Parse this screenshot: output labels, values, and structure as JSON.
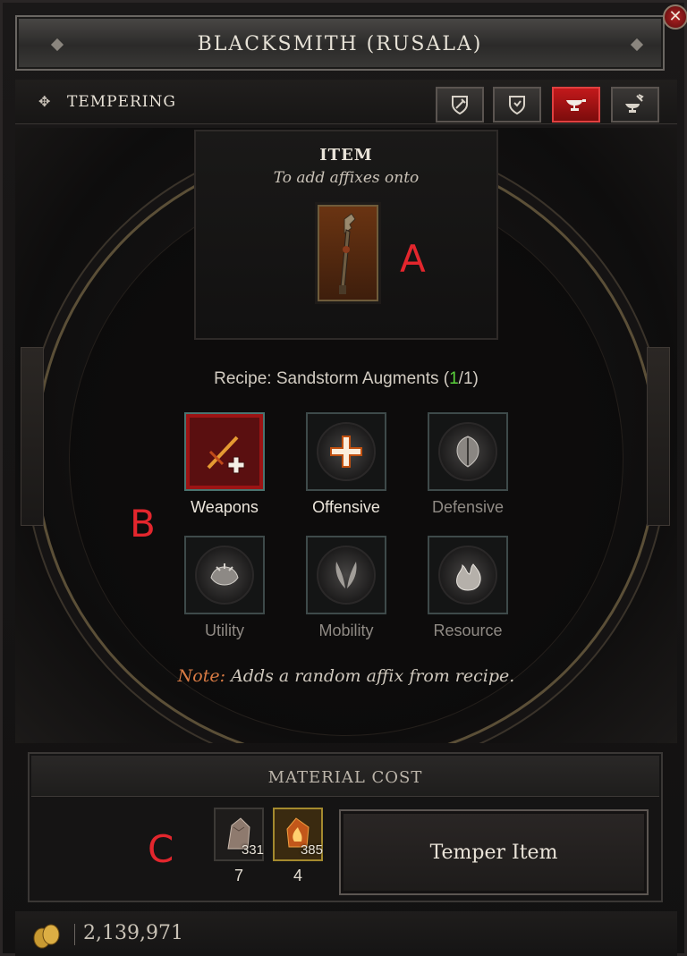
{
  "header": {
    "title": "BLACKSMITH (RUSALA)",
    "close_icon": "close-icon"
  },
  "subbar": {
    "tab_label": "TEMPERING",
    "tab_icon": "diamond-cross-icon",
    "modes": [
      {
        "name": "salvage-mode",
        "icon": "hammer-shield-icon",
        "active": false
      },
      {
        "name": "repair-mode",
        "icon": "shield-icon",
        "active": false
      },
      {
        "name": "temper-mode",
        "icon": "anvil-icon",
        "active": true
      },
      {
        "name": "masterwork-mode",
        "icon": "anvil-hammer-icon",
        "active": false
      }
    ],
    "active_color": "#c2191b"
  },
  "item": {
    "title": "ITEM",
    "subtitle": "To add affixes onto",
    "icon": "polearm-icon"
  },
  "annotations": {
    "a": "A",
    "b": "B",
    "c": "C"
  },
  "recipe": {
    "prefix": "Recipe: Sandstorm Augments (",
    "count": "1",
    "suffix": "/1)"
  },
  "affixes": [
    {
      "label": "Weapons",
      "icon": "weapons-icon",
      "selected": true,
      "enabled": true
    },
    {
      "label": "Offensive",
      "icon": "offensive-cross-icon",
      "selected": false,
      "enabled": true
    },
    {
      "label": "Defensive",
      "icon": "defensive-shield-icon",
      "selected": false,
      "enabled": false
    },
    {
      "label": "Utility",
      "icon": "utility-icon",
      "selected": false,
      "enabled": false
    },
    {
      "label": "Mobility",
      "icon": "mobility-wings-icon",
      "selected": false,
      "enabled": false
    },
    {
      "label": "Resource",
      "icon": "resource-flame-icon",
      "selected": false,
      "enabled": false
    }
  ],
  "note": {
    "prefix": "Note:",
    "text": " Adds a random affix from recipe."
  },
  "material": {
    "header": "MATERIAL COST",
    "items": [
      {
        "icon": "rock-material-icon",
        "have": "331",
        "need": "7"
      },
      {
        "icon": "fire-crystal-icon",
        "have": "385",
        "need": "4"
      }
    ],
    "button_label": "Temper Item"
  },
  "footer": {
    "gold": "2,139,971",
    "coins_icon": "gold-coins-icon"
  }
}
